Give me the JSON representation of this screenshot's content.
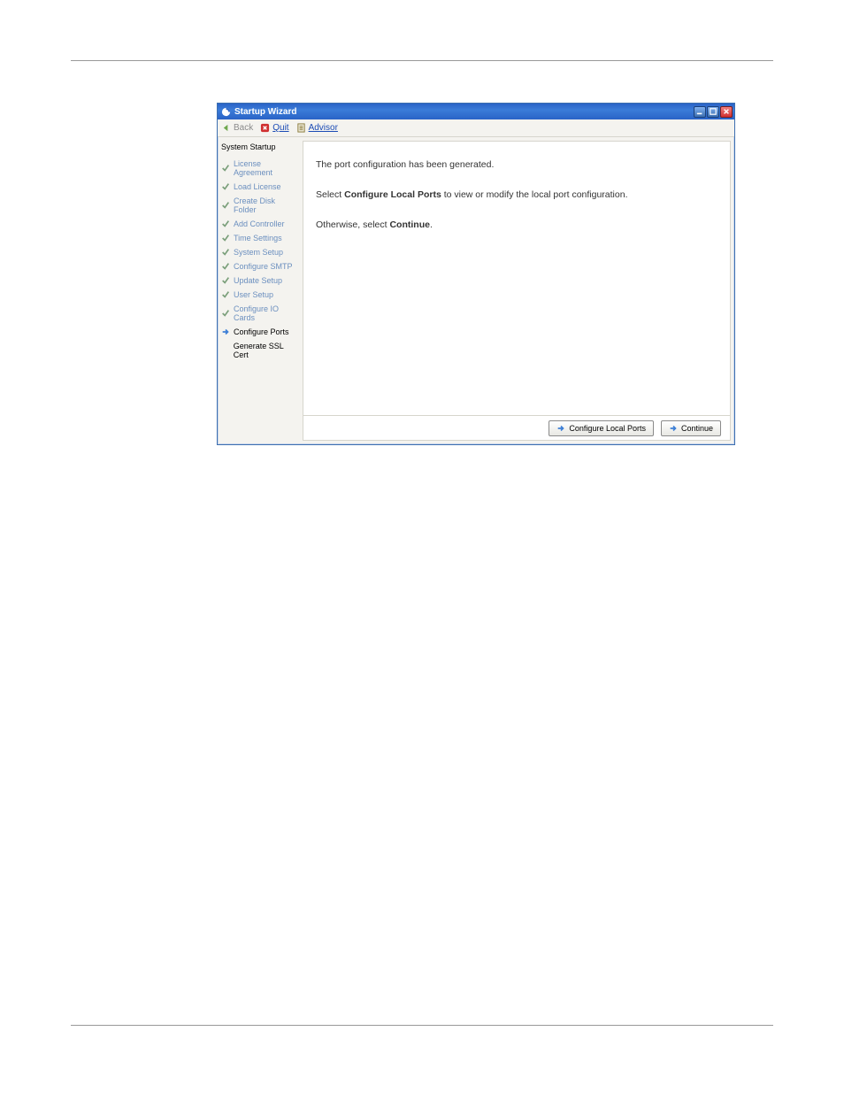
{
  "window": {
    "title": "Startup Wizard"
  },
  "toolbar": {
    "back": "Back",
    "quit": "Quit",
    "advisor": "Advisor"
  },
  "sidebar": {
    "header": "System Startup",
    "steps": [
      {
        "label": "License Agreement",
        "state": "done"
      },
      {
        "label": "Load License",
        "state": "done"
      },
      {
        "label": "Create Disk Folder",
        "state": "done"
      },
      {
        "label": "Add Controller",
        "state": "done"
      },
      {
        "label": "Time Settings",
        "state": "done"
      },
      {
        "label": "System Setup",
        "state": "done"
      },
      {
        "label": "Configure SMTP",
        "state": "done"
      },
      {
        "label": "Update Setup",
        "state": "done"
      },
      {
        "label": "User Setup",
        "state": "done"
      },
      {
        "label": "Configure IO Cards",
        "state": "done"
      },
      {
        "label": "Configure Ports",
        "state": "active"
      },
      {
        "label": "Generate SSL Cert",
        "state": "future"
      }
    ]
  },
  "content": {
    "line1": "The port configuration has been generated.",
    "line2_pre": "Select ",
    "line2_bold": "Configure Local Ports",
    "line2_post": " to view or modify the local port configuration.",
    "line3_pre": "Otherwise, select ",
    "line3_bold": "Continue",
    "line3_post": "."
  },
  "buttons": {
    "configure": "Configure Local Ports",
    "continue": "Continue"
  }
}
